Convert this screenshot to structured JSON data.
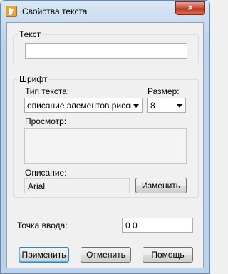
{
  "window": {
    "title": "Свойства текста",
    "close_glyph": "×"
  },
  "text_group": {
    "label": "Текст",
    "value": ""
  },
  "font_group": {
    "label": "Шрифт",
    "text_type_label": "Тип текста:",
    "text_type_value": "описание элементов рисова",
    "size_label": "Размер:",
    "size_value": "8",
    "preview_label": "Просмотр:",
    "description_label": "Описание:",
    "description_value": "Arial",
    "change_button": "Изменить"
  },
  "insertion_point": {
    "label": "Точка ввода:",
    "value": "0 0"
  },
  "buttons": {
    "apply": "Применить",
    "cancel": "Отменить",
    "help": "Помощь"
  },
  "icons": {
    "app": "app-logo-icon",
    "close": "close-icon",
    "dropdown": "chevron-down-icon"
  }
}
